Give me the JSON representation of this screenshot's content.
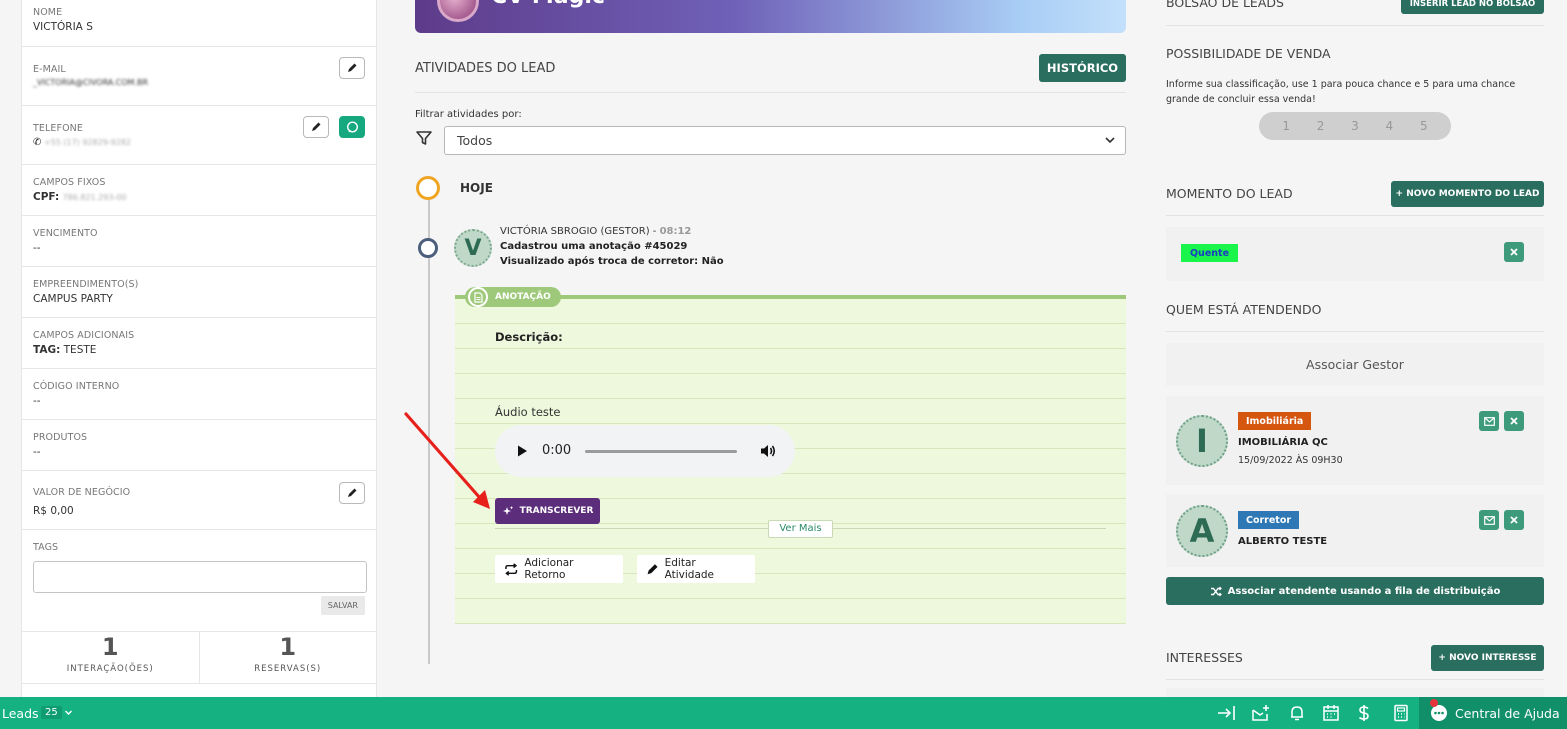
{
  "left_panel": {
    "nome": {
      "label": "NOME",
      "value": "VICTÓRIA S"
    },
    "email": {
      "label": "E-MAIL",
      "value": "_VICTORIA@CIVORA.COM.BR"
    },
    "telefone": {
      "label": "TELEFONE",
      "value": "+55 (17) 92829-9282"
    },
    "campos_fixos": {
      "label": "CAMPOS FIXOS",
      "key": "CPF:",
      "value": "786.821.293-00"
    },
    "vencimento": {
      "label": "VENCIMENTO",
      "value": "--"
    },
    "empreendimento": {
      "label": "EMPREENDIMENTO(S)",
      "value": "CAMPUS PARTY"
    },
    "campos_adicionais": {
      "label": "CAMPOS ADICIONAIS",
      "key": "TAG:",
      "value": "TESTE"
    },
    "codigo_interno": {
      "label": "CÓDIGO INTERNO",
      "value": "--"
    },
    "produtos": {
      "label": "PRODUTOS",
      "value": "--"
    },
    "valor_negocio": {
      "label": "VALOR DE NEGÓCIO",
      "value": "R$ 0,00"
    },
    "tags": {
      "label": "TAGS",
      "value": "",
      "save_label": "SALVAR"
    },
    "stats": [
      {
        "num": "1",
        "label": "INTERAÇÃO(ÕES)"
      },
      {
        "num": "1",
        "label": "RESERVAS(S)"
      }
    ]
  },
  "center": {
    "brand_text": "CV Magic",
    "section_title": "ATIVIDADES DO LEAD",
    "historico_label": "HISTÓRICO",
    "filter_label": "Filtrar atividades por:",
    "filter_value": "Todos",
    "today_label": "HOJE",
    "activity": {
      "author": "VICTÓRIA SBROGIO (GESTOR) - ",
      "time": "08:12",
      "avatar_letter": "V",
      "line2": "Cadastrou uma anotação #45029",
      "line3": "Visualizado após troca de corretor: Não"
    },
    "note": {
      "tag": "ANOTAÇÃO",
      "desc_label": "Descrição:",
      "audio_label": "Áudio teste",
      "audio_time": "0:00",
      "transcribe_label": "TRANSCREVER",
      "ver_mais": "Ver Mais",
      "add_retorno": "Adicionar Retorno",
      "editar": "Editar Atividade"
    }
  },
  "right": {
    "bolsao_title": "BOLSÃO DE LEADS",
    "inserir_label": "INSERIR LEAD NO BOLSÃO",
    "possibilidade_title": "POSSIBILIDADE DE VENDA",
    "possibilidade_info": "Informe sua classificação, use 1 para pouca chance e 5 para uma chance grande de concluir essa venda!",
    "rating": [
      "1",
      "2",
      "3",
      "4",
      "5"
    ],
    "momento_title": "MOMENTO DO LEAD",
    "novo_momento_label": "+ NOVO MOMENTO DO LEAD",
    "momento_value": "Quente",
    "quem_title": "QUEM ESTÁ ATENDENDO",
    "associar_gestor": "Associar Gestor",
    "atendentes": [
      {
        "letter": "I",
        "badge": "Imobiliária",
        "name": "IMOBILIÁRIA QC",
        "date": "15/09/2022 ÀS 09H30",
        "badge_color": "#d4560f"
      },
      {
        "letter": "A",
        "badge": "Corretor",
        "name": "ALBERTO TESTE",
        "date": "",
        "badge_color": "#2e78b5"
      }
    ],
    "fila_label": "Associar atendente usando a fila de distribuição",
    "interesses_title": "INTERESSES",
    "novo_interesse_label": "+ NOVO INTERESSE"
  },
  "bottom_bar": {
    "leads_label": "Leads",
    "leads_count": "25",
    "central_label": "Central de Ajuda"
  },
  "colors": {
    "primary": "#2a6e5f",
    "bottom_bar": "#15b180",
    "transcribe": "#5b2d7a",
    "note_bg": "#eef8dd",
    "today_ring": "#f0a424"
  }
}
